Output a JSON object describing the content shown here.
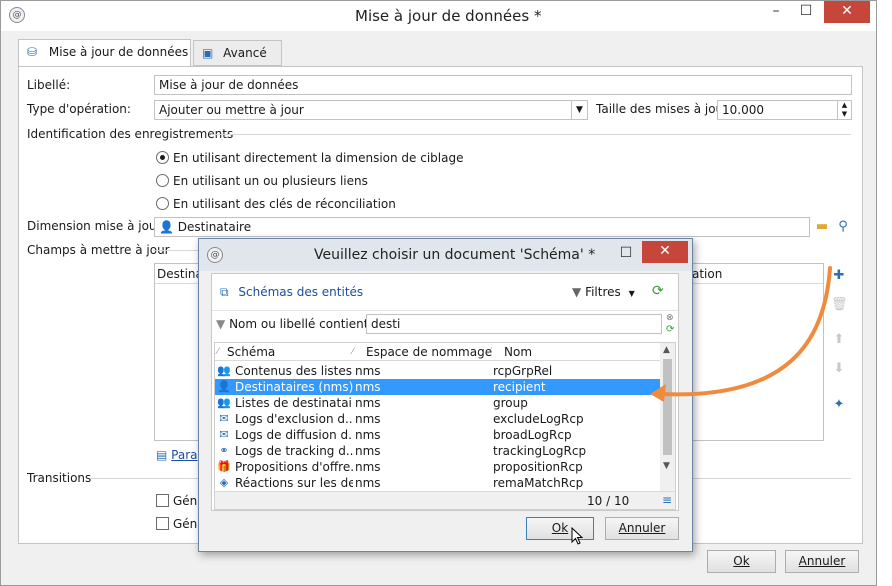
{
  "main_window": {
    "title": "Mise à jour de données *",
    "tabs": [
      {
        "label": "Mise à jour de données"
      },
      {
        "label": "Avancé"
      }
    ],
    "form": {
      "libelle_label": "Libellé:",
      "libelle_value": "Mise à jour de données",
      "type_op_label": "Type d'opération:",
      "type_op_value": "Ajouter ou mettre à jour",
      "taille_label": "Taille des mises à jour:",
      "taille_value": "10.000",
      "identification_section": "Identification des enregistrements",
      "radios": [
        {
          "label": "En utilisant directement la dimension de ciblage",
          "checked": true
        },
        {
          "label": "En utilisant un ou plusieurs liens",
          "checked": false
        },
        {
          "label": "En utilisant des clés de réconciliation",
          "checked": false
        }
      ],
      "dimension_label": "Dimension mise à jour:",
      "dimension_value": "Destinataire",
      "champs_section": "Champs à mettre à jour",
      "champs_col1": "Destinat",
      "champs_col2": "ation",
      "param_link": "Para",
      "transitions_section": "Transitions",
      "checkbox1_label": "Géné",
      "checkbox2_label": "Géné"
    },
    "ok_label": "Ok",
    "annuler_label": "Annuler"
  },
  "dialog": {
    "title": "Veuillez choisir un document 'Schéma' *",
    "folder_label": "Schémas des entités",
    "filters_label": "Filtres",
    "search_label": "Nom ou libellé contient:",
    "search_value": "desti",
    "columns": [
      "Schéma",
      "Espace de nommage",
      "Nom"
    ],
    "rows": [
      {
        "schema": "Contenus des listes...",
        "ns": "nms",
        "name": "rcpGrpRel",
        "icon": "group-icon",
        "selected": false
      },
      {
        "schema": "Destinataires (nms)",
        "ns": "nms",
        "name": "recipient",
        "icon": "person-icon",
        "selected": true
      },
      {
        "schema": "Listes de destinatai...",
        "ns": "nms",
        "name": "group",
        "icon": "group-icon",
        "selected": false
      },
      {
        "schema": "Logs d'exclusion d...",
        "ns": "nms",
        "name": "excludeLogRcp",
        "icon": "envelope-icon",
        "selected": false
      },
      {
        "schema": "Logs de diffusion d...",
        "ns": "nms",
        "name": "broadLogRcp",
        "icon": "envelope-icon",
        "selected": false
      },
      {
        "schema": "Logs de tracking d...",
        "ns": "nms",
        "name": "trackingLogRcp",
        "icon": "tracking-icon",
        "selected": false
      },
      {
        "schema": "Propositions d'offre...",
        "ns": "nms",
        "name": "propositionRcp",
        "icon": "gift-icon",
        "selected": false
      },
      {
        "schema": "Réactions sur les des...",
        "ns": "nms",
        "name": "remaMatchRcp",
        "icon": "reaction-icon",
        "selected": false
      }
    ],
    "count": "10 / 10",
    "ok_label": "Ok",
    "annuler_label": "Annuler"
  },
  "colors": {
    "selection": "#3399ff",
    "close_button": "#c7463c",
    "arrow": "#f08a3c",
    "link": "#1d4fa0"
  }
}
